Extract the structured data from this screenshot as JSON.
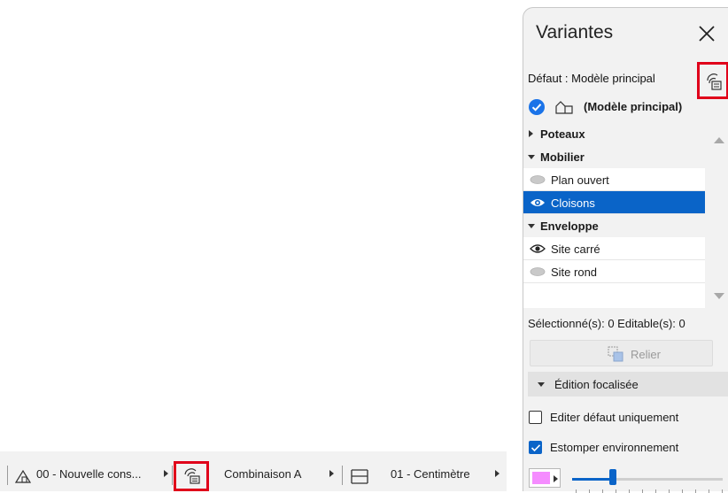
{
  "statusbar": {
    "story": "00 - Nouvelle cons...",
    "combination": "Combinaison A",
    "dimension": "01 - Centimètre"
  },
  "palette": {
    "title": "Variantes",
    "default_label": "Défaut : Modèle principal",
    "main_model": "(Modèle principal)",
    "tree": [
      {
        "type": "group",
        "label": "Poteaux",
        "expanded": false
      },
      {
        "type": "group",
        "label": "Mobilier",
        "expanded": true
      },
      {
        "type": "item",
        "label": "Plan ouvert",
        "visible": false,
        "selected": false
      },
      {
        "type": "item",
        "label": "Cloisons",
        "visible": true,
        "selected": true
      },
      {
        "type": "group",
        "label": "Enveloppe",
        "expanded": true
      },
      {
        "type": "item",
        "label": "Site carré",
        "visible": true,
        "selected": false
      },
      {
        "type": "item",
        "label": "Site rond",
        "visible": false,
        "selected": false
      }
    ],
    "status_count": "Sélectionné(s): 0 Editable(s): 0",
    "link_label": "Relier",
    "focus_section": "Édition focalisée",
    "checkbox_default_only": {
      "label": "Editer défaut uniquement",
      "checked": false
    },
    "checkbox_fade": {
      "label": "Estomper environnement",
      "checked": true
    },
    "fade_color": "#f58cff",
    "fade_level": 0.27
  },
  "colors": {
    "accent": "#0a64c8",
    "highlight_box": "#e0001a"
  }
}
